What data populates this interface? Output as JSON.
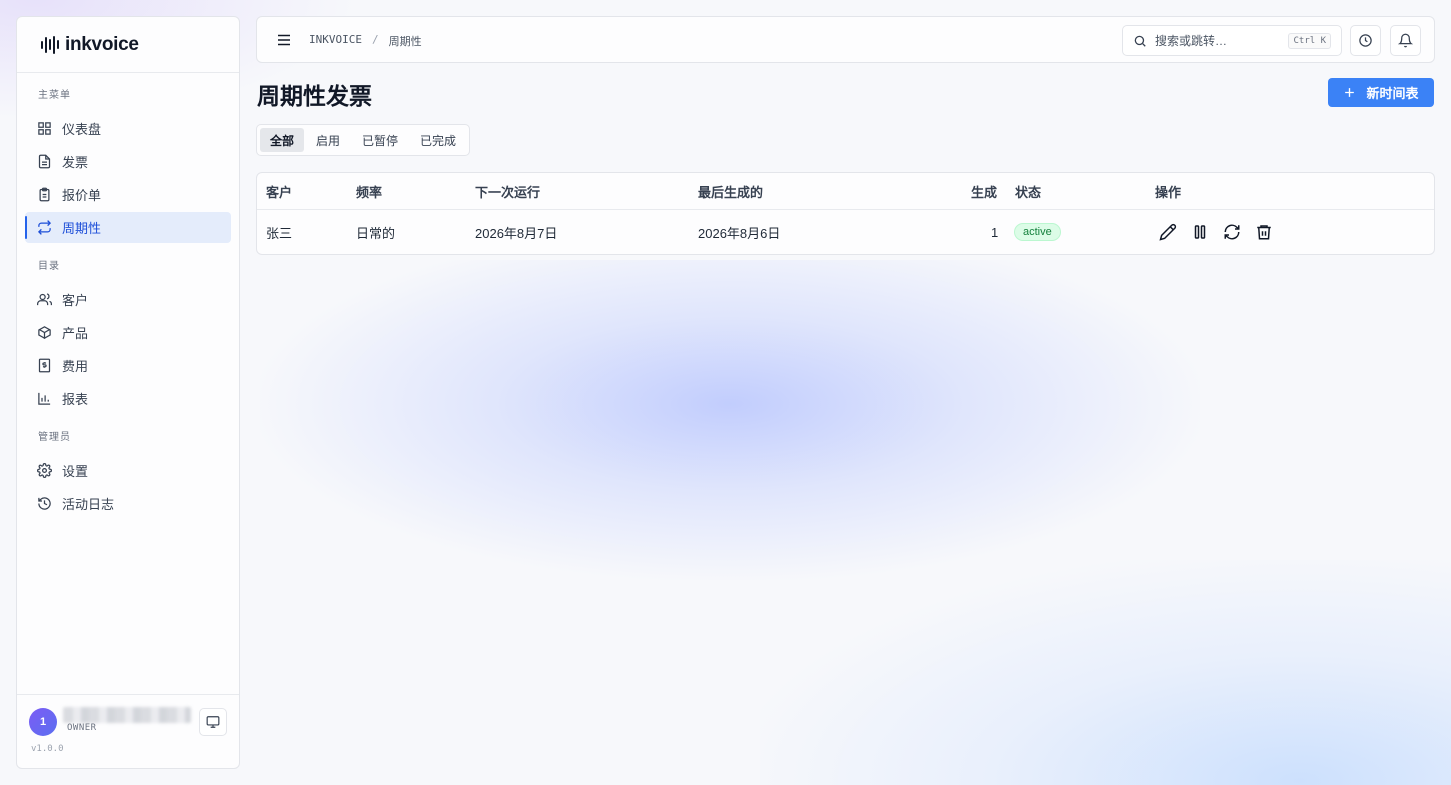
{
  "app": {
    "brand": "inkvoice",
    "version": "v1.0.0"
  },
  "sidebar": {
    "sections": [
      {
        "heading": "主菜单",
        "items": [
          {
            "label": "仪表盘",
            "icon": "dashboard-icon"
          },
          {
            "label": "发票",
            "icon": "file-text-icon"
          },
          {
            "label": "报价单",
            "icon": "clipboard-icon"
          },
          {
            "label": "周期性",
            "icon": "repeat-icon",
            "active": true
          }
        ]
      },
      {
        "heading": "目录",
        "items": [
          {
            "label": "客户",
            "icon": "users-icon"
          },
          {
            "label": "产品",
            "icon": "package-icon"
          },
          {
            "label": "费用",
            "icon": "receipt-icon"
          },
          {
            "label": "报表",
            "icon": "bar-chart-icon"
          }
        ]
      },
      {
        "heading": "管理员",
        "items": [
          {
            "label": "设置",
            "icon": "gear-icon"
          },
          {
            "label": "活动日志",
            "icon": "history-icon"
          }
        ]
      }
    ],
    "user": {
      "initial": "1",
      "role": "OWNER"
    }
  },
  "topbar": {
    "breadcrumb": [
      "INKVOICE",
      "周期性"
    ],
    "search_placeholder": "搜索或跳转…",
    "search_shortcut": "Ctrl K"
  },
  "page": {
    "title": "周期性发票",
    "new_button": "新时间表",
    "filter_tabs": [
      {
        "label": "全部",
        "active": true
      },
      {
        "label": "启用"
      },
      {
        "label": "已暂停"
      },
      {
        "label": "已完成"
      }
    ]
  },
  "table": {
    "columns": [
      "客户",
      "频率",
      "下一次运行",
      "最后生成的",
      "生成",
      "状态",
      "操作"
    ],
    "rows": [
      {
        "client": "张三",
        "frequency": "日常的",
        "next_run": "2026年8月7日",
        "last_generated": "2026年8月6日",
        "generated": "1",
        "status": "active"
      }
    ]
  },
  "colors": {
    "accent": "#3b82f6",
    "status_active_bg": "#dcfce7",
    "status_active_fg": "#15803d"
  }
}
